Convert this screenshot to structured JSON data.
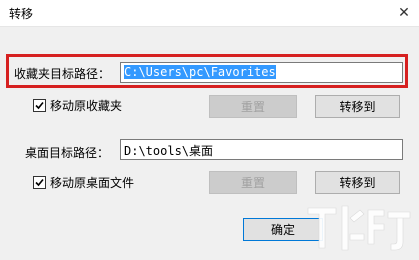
{
  "window": {
    "title": "转移",
    "close_glyph": "✕"
  },
  "favorites": {
    "label": "收藏夹目标路径：",
    "path_value": "C:\\Users\\pc\\Favorites",
    "move_original_label": "移动原收藏夹",
    "move_original_checked": true,
    "reset_label": "重置",
    "move_to_label": "转移到"
  },
  "desktop": {
    "label": "桌面目标路径：",
    "path_value": "D:\\tools\\桌面",
    "move_original_label": "移动原桌面文件",
    "move_original_checked": true,
    "reset_label": "重置",
    "move_to_label": "转移到"
  },
  "footer": {
    "confirm_label": "确定"
  },
  "colors": {
    "highlight": "#d62020",
    "selection": "#3399ff",
    "accent": "#0078d7"
  }
}
